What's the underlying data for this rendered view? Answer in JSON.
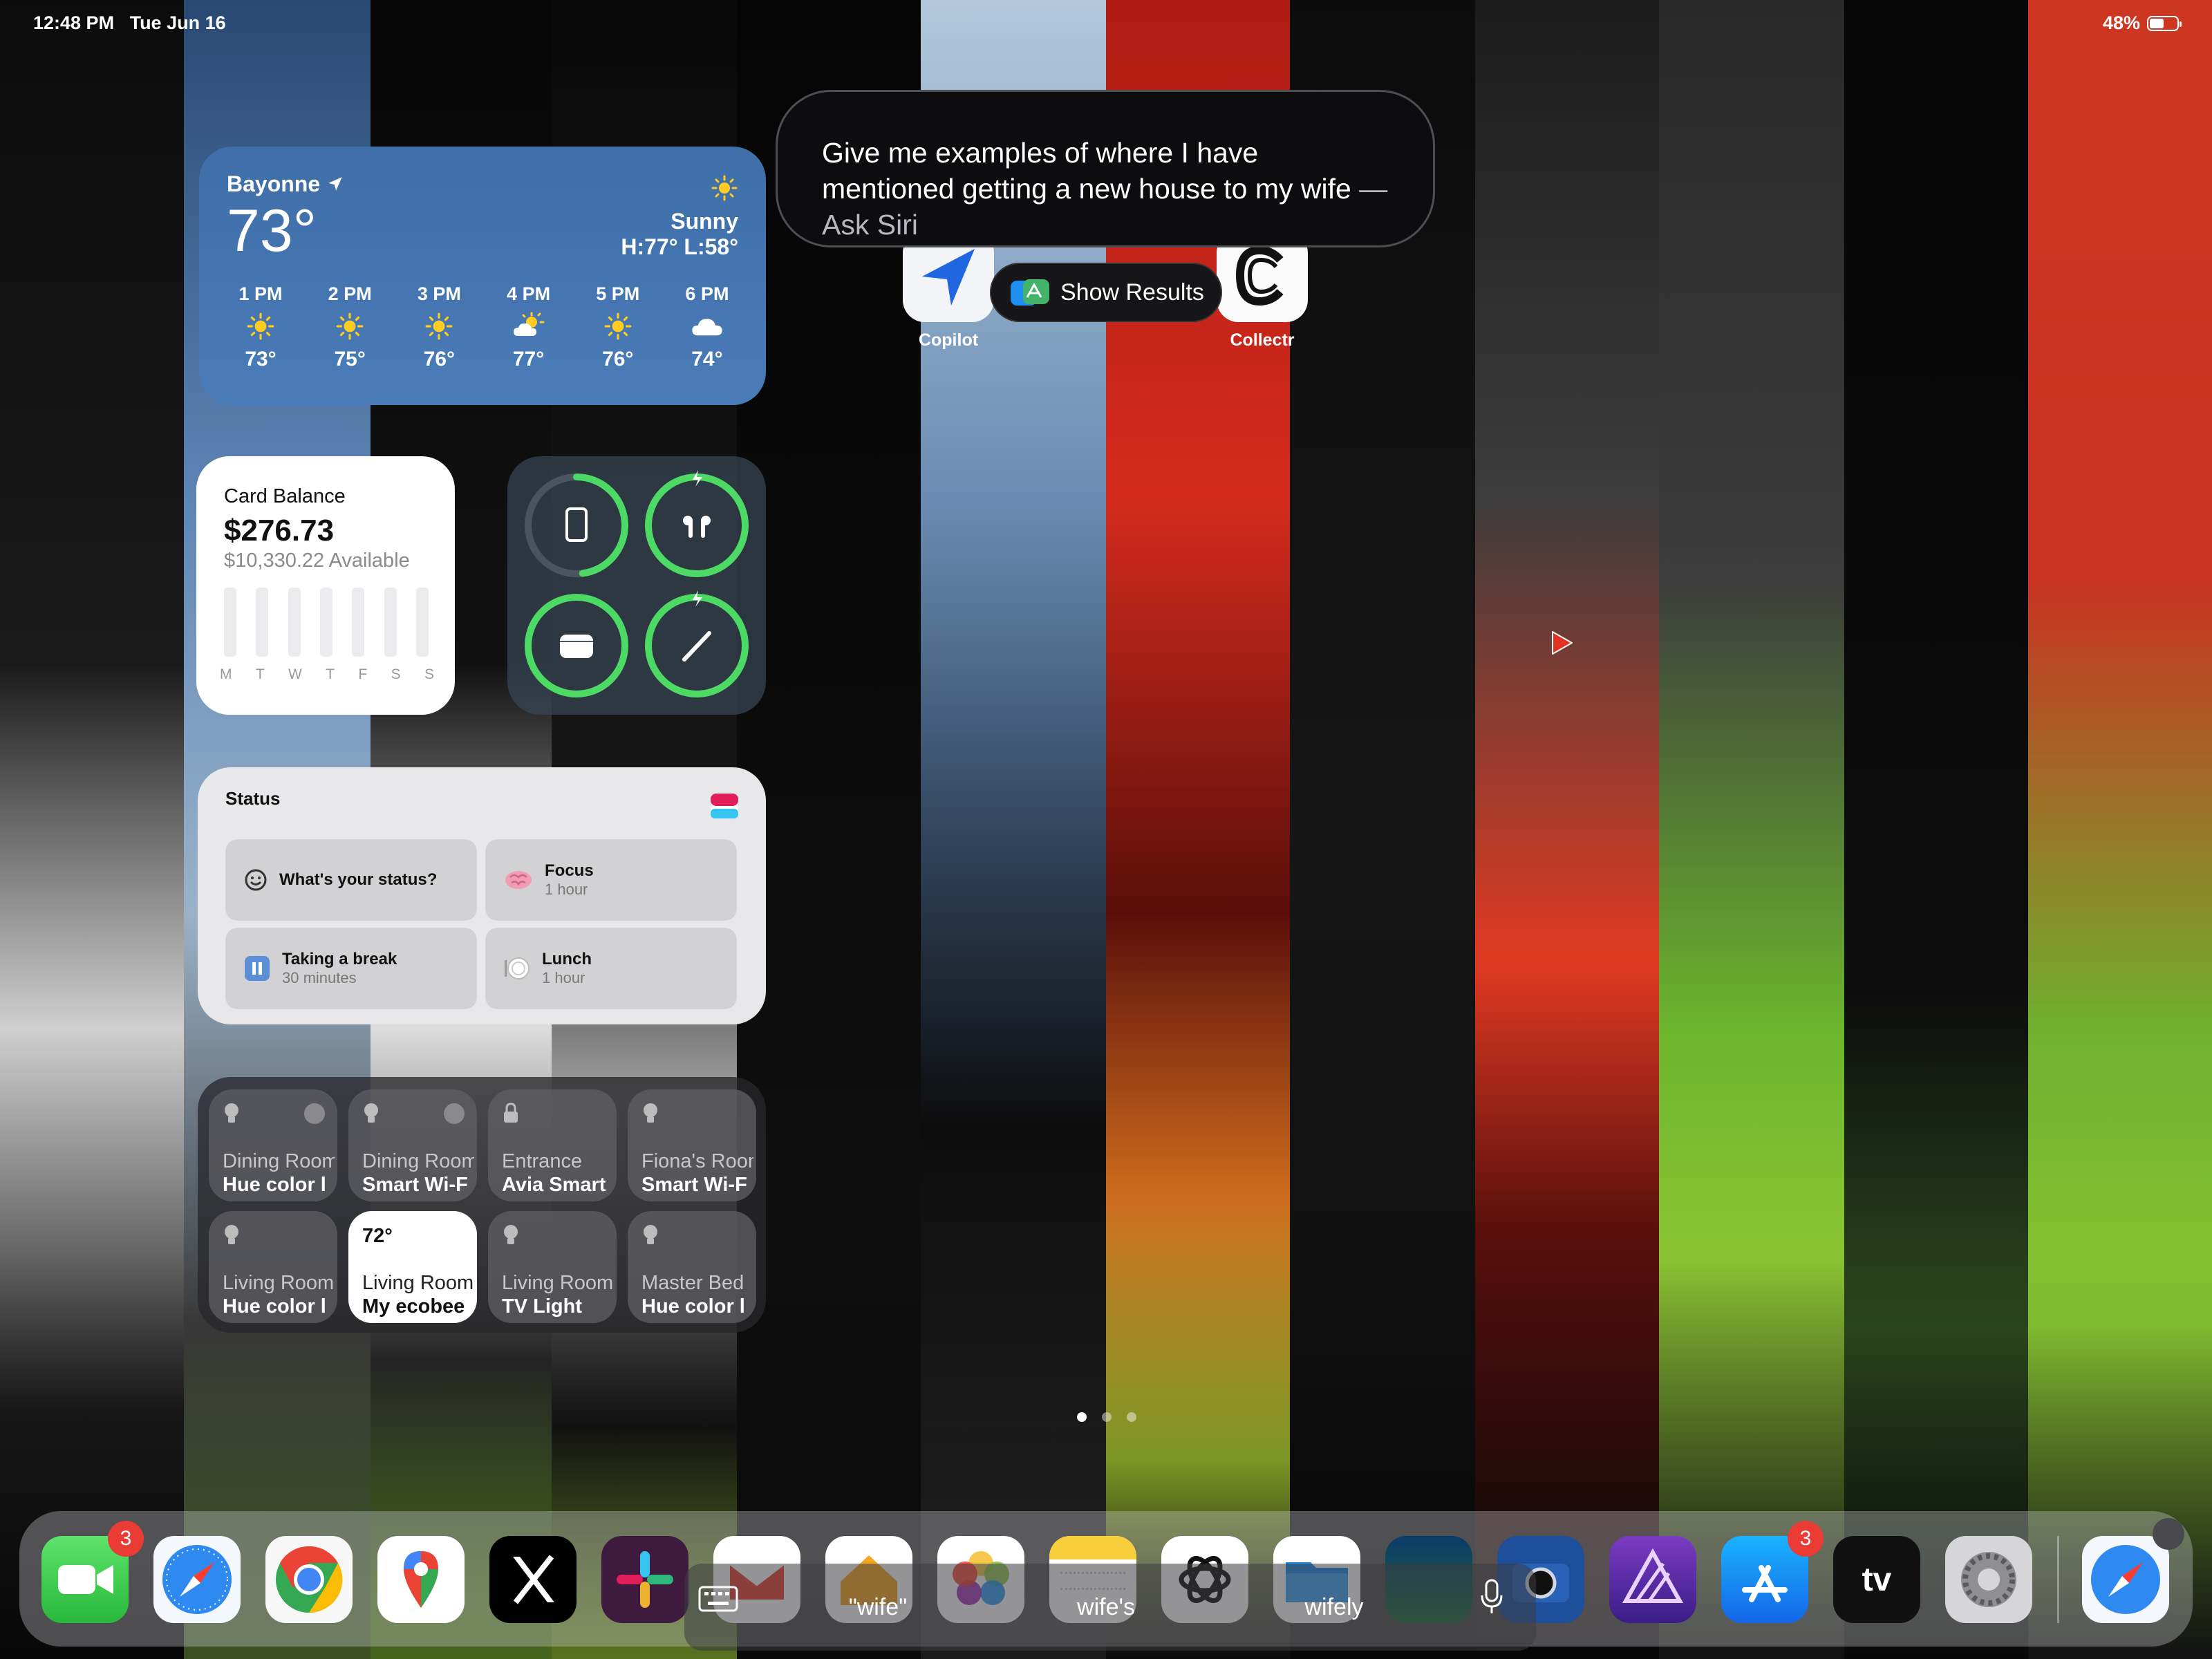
{
  "status_bar": {
    "time": "12:48 PM",
    "date": "Tue Jun 16",
    "battery_text": "48%",
    "battery_level": 0.48
  },
  "weather": {
    "city": "Bayonne",
    "temp": "73°",
    "condition": "Sunny",
    "hilo": "H:77° L:58°",
    "hours": [
      {
        "time": "1 PM",
        "icon": "sun-icon",
        "temp": "73°"
      },
      {
        "time": "2 PM",
        "icon": "sun-icon",
        "temp": "75°"
      },
      {
        "time": "3 PM",
        "icon": "sun-icon",
        "temp": "76°"
      },
      {
        "time": "4 PM",
        "icon": "partly-cloudy-icon",
        "temp": "77°"
      },
      {
        "time": "5 PM",
        "icon": "sun-icon",
        "temp": "76°"
      },
      {
        "time": "6 PM",
        "icon": "cloud-icon",
        "temp": "74°"
      }
    ]
  },
  "card": {
    "label": "Card Balance",
    "amount": "$276.73",
    "available": "$10,330.22 Available",
    "days": [
      "M",
      "T",
      "W",
      "T",
      "F",
      "S",
      "S"
    ]
  },
  "batteries": {
    "accent": "#4cd964",
    "devices": [
      {
        "name": "ipad-icon",
        "level": 0.48
      },
      {
        "name": "airpods-icon",
        "level": 1.0,
        "charging": true
      },
      {
        "name": "airpods-case-icon",
        "level": 1.0
      },
      {
        "name": "pencil-icon",
        "level": 1.0,
        "charging": true
      }
    ]
  },
  "status_widget": {
    "title": "Status",
    "items": [
      {
        "label": "What's your status?",
        "sub": ""
      },
      {
        "label": "Focus",
        "sub": "1 hour"
      },
      {
        "label": "Taking a break",
        "sub": "30 minutes"
      },
      {
        "label": "Lunch",
        "sub": "1 hour"
      }
    ]
  },
  "home": {
    "tiles": [
      {
        "room": "Dining Room",
        "device": "Hue color l",
        "icon": "bulb-icon"
      },
      {
        "room": "Dining Room",
        "device": "Smart Wi-F",
        "icon": "bulb-icon"
      },
      {
        "room": "Entrance",
        "device": "Avia Smart",
        "icon": "lock-icon"
      },
      {
        "room": "Fiona's Room",
        "device": "Smart Wi-F",
        "icon": "bulb-icon"
      },
      {
        "room": "Living Room",
        "device": "Hue color l",
        "icon": "bulb-icon"
      },
      {
        "room": "Living Room",
        "device": "My ecobee",
        "icon": "thermostat",
        "value": "72°"
      },
      {
        "room": "Living Room",
        "device": "TV Light",
        "icon": "bulb-icon"
      },
      {
        "room": "Master Bed",
        "device": "Hue color l",
        "icon": "bulb-icon"
      }
    ]
  },
  "siri": {
    "query": "Give me examples of where I have mentioned getting a new house to my wife",
    "hint": "— Ask Siri"
  },
  "apps": {
    "copilot": "Copilot",
    "collectr": "Collectr",
    "show_results": "Show Results"
  },
  "page_dots": {
    "count": 3,
    "active": 0
  },
  "dock": {
    "apps": [
      {
        "name": "facetime-icon",
        "badge": "3"
      },
      {
        "name": "safari-icon"
      },
      {
        "name": "chrome-icon"
      },
      {
        "name": "google-maps-icon"
      },
      {
        "name": "x-icon"
      },
      {
        "name": "slack-icon"
      },
      {
        "name": "gmail-icon"
      },
      {
        "name": "home-app-icon"
      },
      {
        "name": "photos-icon"
      },
      {
        "name": "notes-icon"
      },
      {
        "name": "chatgpt-icon"
      },
      {
        "name": "files-icon"
      },
      {
        "name": "maps-3d-icon"
      },
      {
        "name": "camera-app-icon"
      },
      {
        "name": "affinity-photo-icon"
      },
      {
        "name": "app-store-icon",
        "badge": "3"
      },
      {
        "name": "apple-tv-icon",
        "label": "tv"
      },
      {
        "name": "settings-icon"
      },
      {
        "name": "safari-recent-icon"
      }
    ],
    "quicktype": [
      "\"wife\"",
      "wife's",
      "wifely"
    ]
  }
}
